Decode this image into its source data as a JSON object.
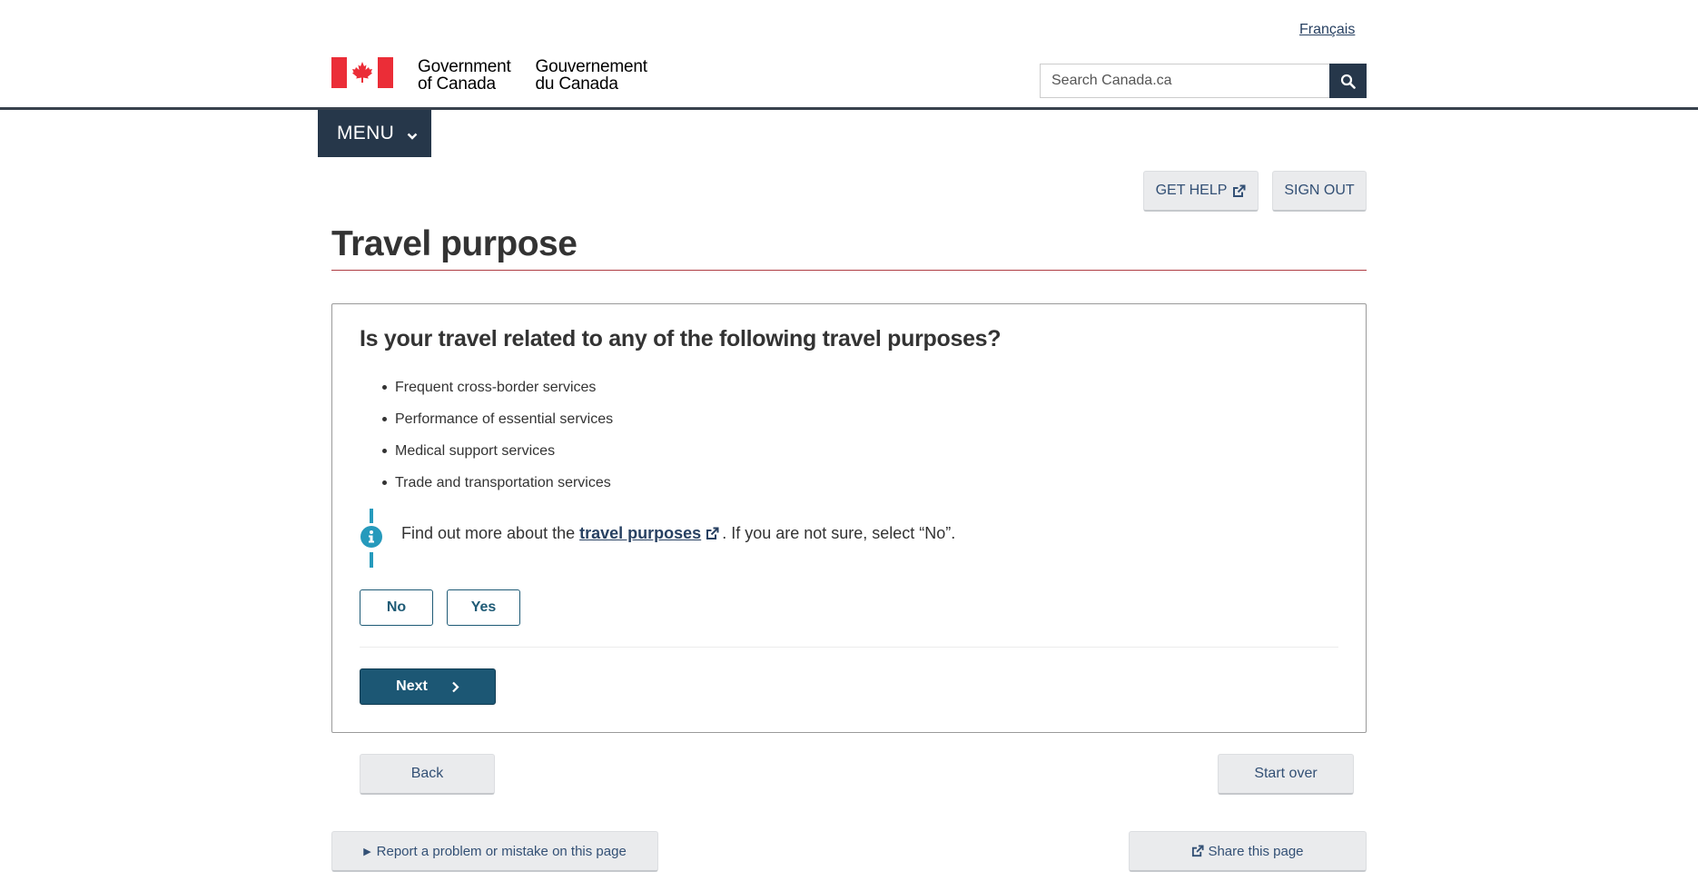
{
  "header": {
    "language_link": "Français",
    "signature_en_line1": "Government",
    "signature_en_line2": "of Canada",
    "signature_fr_line1": "Gouvernement",
    "signature_fr_line2": "du Canada",
    "search_placeholder": "Search Canada.ca",
    "search_icon": "search-icon",
    "menu_label": "MENU"
  },
  "actions": {
    "get_help_label": "GET HELP",
    "sign_out_label": "SIGN OUT"
  },
  "page": {
    "title": "Travel purpose",
    "question": "Is your travel related to any of the following travel purposes?",
    "purposes": [
      "Frequent cross-border services",
      "Performance of essential services",
      "Medical support services",
      "Trade and transportation services"
    ],
    "info_prefix": "Find out more about the",
    "info_link": "travel purposes",
    "info_suffix": ". If you are not sure, select “No”.",
    "no_label": "No",
    "yes_label": "Yes",
    "next_label": "Next",
    "back_label": "Back",
    "start_over_label": "Start over"
  },
  "footer": {
    "report_label": "Report a problem or mistake on this page",
    "share_label": "Share this page"
  },
  "colors": {
    "brand_dark": "#26374a",
    "flag_red": "#eb2d37",
    "title_rule": "#af3c43",
    "primary_button": "#1c5774",
    "info_blue": "#269abc",
    "link": "#284162"
  }
}
